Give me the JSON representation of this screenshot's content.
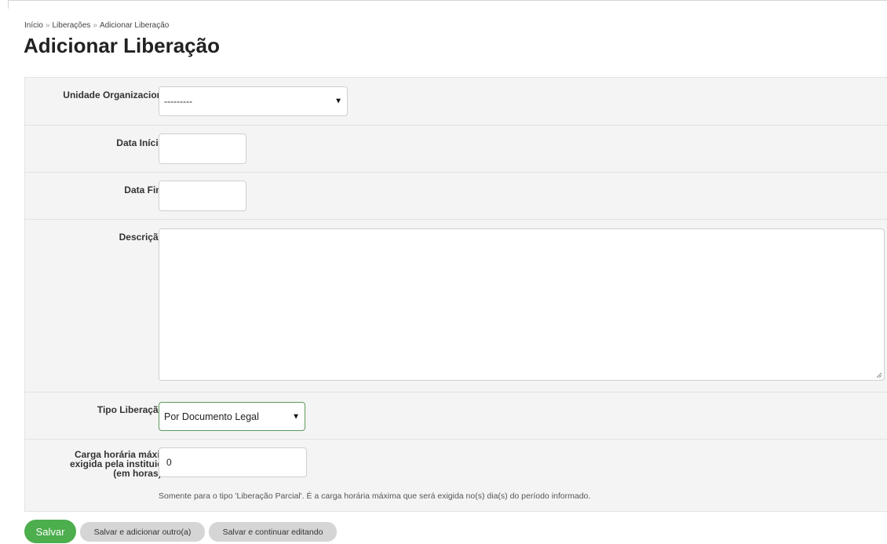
{
  "breadcrumb": {
    "home": "Início",
    "separator": "»",
    "level2": "Liberações",
    "current": "Adicionar Liberação"
  },
  "page_title": "Adicionar Liberação",
  "form": {
    "required_mark": "*",
    "unidade": {
      "label": "Unidade Organizacional:",
      "value": "---------"
    },
    "data_inicio": {
      "label": "Data Início:",
      "value": ""
    },
    "data_fim": {
      "label": "Data Fim:",
      "value": ""
    },
    "descricao": {
      "label": "Descrição:",
      "value": ""
    },
    "tipo": {
      "label": "Tipo Liberação:",
      "value": "Por Documento Legal"
    },
    "carga": {
      "label_line1": "Carga horária máxima",
      "label_line2": "exigida pela instituição",
      "label_line3": "(em horas) :",
      "value": "0",
      "help": "Somente para o tipo 'Liberação Parcial'. É a carga horária máxima que será exigida no(s) dia(s) do período informado."
    }
  },
  "buttons": {
    "save": "Salvar",
    "save_add": "Salvar e adicionar outro(a)",
    "save_continue": "Salvar e continuar editando"
  },
  "colors": {
    "save_button": "#4cae4c",
    "required": "#d9534f",
    "form_background": "#f4f4f4"
  }
}
